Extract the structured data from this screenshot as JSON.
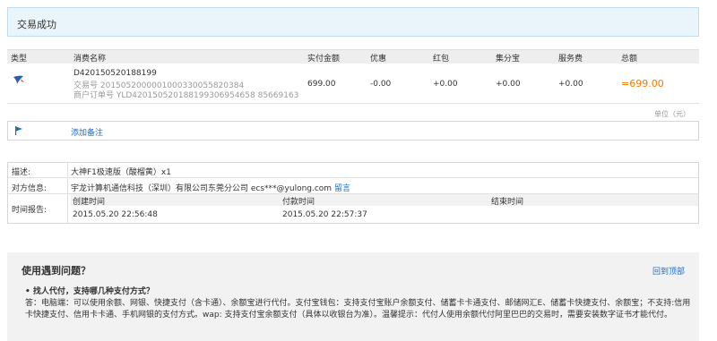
{
  "banner": {
    "title": "交易成功"
  },
  "table": {
    "headers": [
      "类型",
      "消费名称",
      "实付金额",
      "优惠",
      "红包",
      "集分宝",
      "服务费",
      "总额"
    ],
    "row": {
      "order_no": "D420150520188199",
      "trade_no": "交易号 2015052000001000330055820384",
      "merchant_order_no": "商户订单号 YLD420150520188199306954658 85669163",
      "paid": "699.00",
      "discount": "-0.00",
      "red_packet": "+0.00",
      "jifenbao": "+0.00",
      "service_fee": "+0.00",
      "total": "=699.00"
    },
    "unit": "单位（元）"
  },
  "note": {
    "link": "添加备注"
  },
  "info": {
    "desc_label": "描述:",
    "desc_value": "大神F1极速版（酸榴黄）x1",
    "party_label": "对方信息:",
    "party_value": "宇龙计算机通信科技（深圳）有限公司东莞分公司 ecs***@yulong.com",
    "party_msg": "留言",
    "time_label": "时间报告:",
    "time_headers": [
      "创建时间",
      "付款时间",
      "结束时间"
    ],
    "time_values": [
      "2015.05.20 22:56:48",
      "2015.05.20 22:57:37",
      ""
    ]
  },
  "help": {
    "title": "使用遇到问题？",
    "back_top": "回到顶部",
    "question": "• 找人代付，支持哪几种支付方式？",
    "answer": "答：电脑端：可以使用余额、网银、快捷支付（含卡通）、余额宝进行代付。支付宝钱包：支持支付宝账户余额支付、储蓄卡卡通支付、邮储网汇E、储蓄卡快捷支付、余额宝；不支持:信用卡快捷支付、信用卡卡通、手机网银的支付方式。wap: 支持支付宝余额支付（具体以收银台为准）。温馨提示：代付人使用余额代付阿里巴巴的交易时，需要安装数字证书才能代付。"
  },
  "colors": {
    "accent": "#1b6ec2",
    "total": "#f37b00",
    "banner_bg": "#eaf4fb"
  },
  "icons": {
    "type_icon": "bird-icon",
    "note_icon": "flag-icon"
  }
}
